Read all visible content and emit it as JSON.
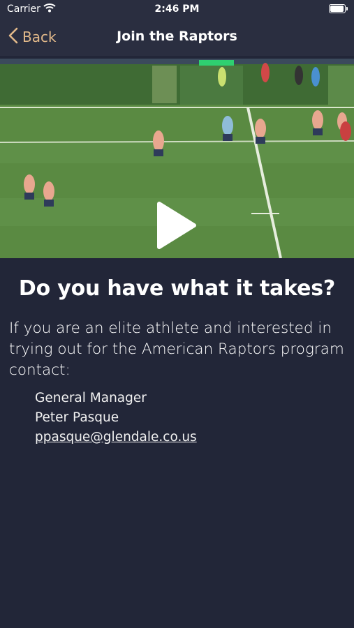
{
  "status_bar": {
    "carrier": "Carrier",
    "time": "2:46 PM"
  },
  "nav": {
    "back_label": "Back",
    "title": "Join the Raptors",
    "accent_color": "#e2b98a"
  },
  "video": {
    "state": "paused"
  },
  "content": {
    "headline": "Do you have what it takes?",
    "intro": "If you are an elite athlete and interested in trying out for the American Raptors program contact:",
    "contact_role": "General Manager",
    "contact_name": "Peter Pasque",
    "contact_email": "ppasque@glendale.co.us"
  }
}
